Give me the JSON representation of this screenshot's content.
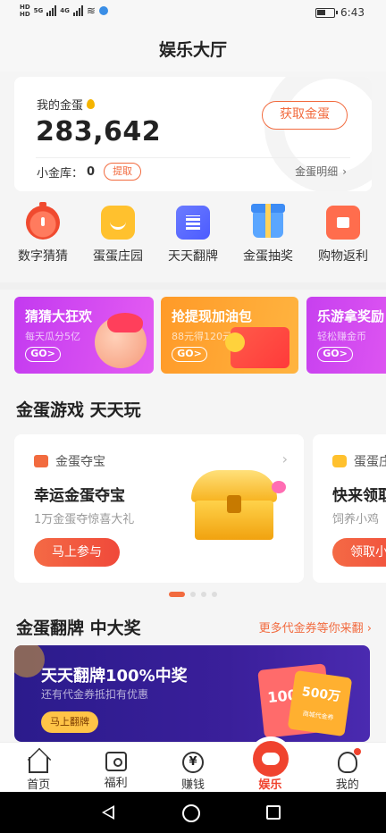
{
  "status_bar": {
    "time": "6:43",
    "signal_1": "5G",
    "signal_2": "4G",
    "battery_percent": 55
  },
  "header": {
    "title": "娱乐大厅"
  },
  "egg_card": {
    "label": "我的金蛋",
    "value": "283,642",
    "get_button": "获取金蛋",
    "vault_label": "小金库：",
    "vault_value": "0",
    "withdraw_button": "提取",
    "detail_link": "金蛋明细",
    "detail_chevron": "›"
  },
  "shortcuts": [
    {
      "label": "数字猜猜",
      "icon": "timer-icon"
    },
    {
      "label": "蛋蛋庄园",
      "icon": "farm-icon"
    },
    {
      "label": "天天翻牌",
      "icon": "flip-card-icon"
    },
    {
      "label": "金蛋抽奖",
      "icon": "gift-box-icon"
    },
    {
      "label": "购物返利",
      "icon": "shopping-bag-icon"
    }
  ],
  "promos": [
    {
      "title": "猜猜大狂欢",
      "subtitle": "每天瓜分5亿",
      "go": "GO>"
    },
    {
      "title": "抢提现加油包",
      "subtitle": "88元得120元",
      "go": "GO>"
    },
    {
      "title": "乐游拿奖励",
      "subtitle": "轻松赚金币",
      "go": "GO>"
    }
  ],
  "games_section": {
    "title": "金蛋游戏 天天玩"
  },
  "games": [
    {
      "tag": "金蛋夺宝",
      "title": "幸运金蛋夺宝",
      "subtitle": "1万金蛋夺惊喜大礼",
      "button": "马上参与",
      "chevron": "›"
    },
    {
      "tag": "蛋蛋庄园",
      "title": "快来领取",
      "subtitle": "饲养小鸡",
      "button": "领取小鸡"
    }
  ],
  "flip_section": {
    "title": "金蛋翻牌 中大奖",
    "more": "更多代金券等你来翻 ›"
  },
  "flip_banner": {
    "title": "天天翻牌100%中奖",
    "subtitle": "还有代金券抵扣有优惠",
    "button": "马上翻牌",
    "ticket_amount": "1000",
    "ticket2_amount": "500万",
    "ticket2_desc": "商城代金券"
  },
  "tabbar": [
    {
      "label": "首页",
      "icon": "home-icon"
    },
    {
      "label": "福利",
      "icon": "gift-icon"
    },
    {
      "label": "赚钱",
      "icon": "yen-icon",
      "glyph": "¥"
    },
    {
      "label": "娱乐",
      "icon": "game-icon",
      "active": true
    },
    {
      "label": "我的",
      "icon": "profile-icon"
    }
  ],
  "colors": {
    "accent": "#f26b3f",
    "active_tab": "#f0432e",
    "banner_bg": "#2b1b8c"
  }
}
